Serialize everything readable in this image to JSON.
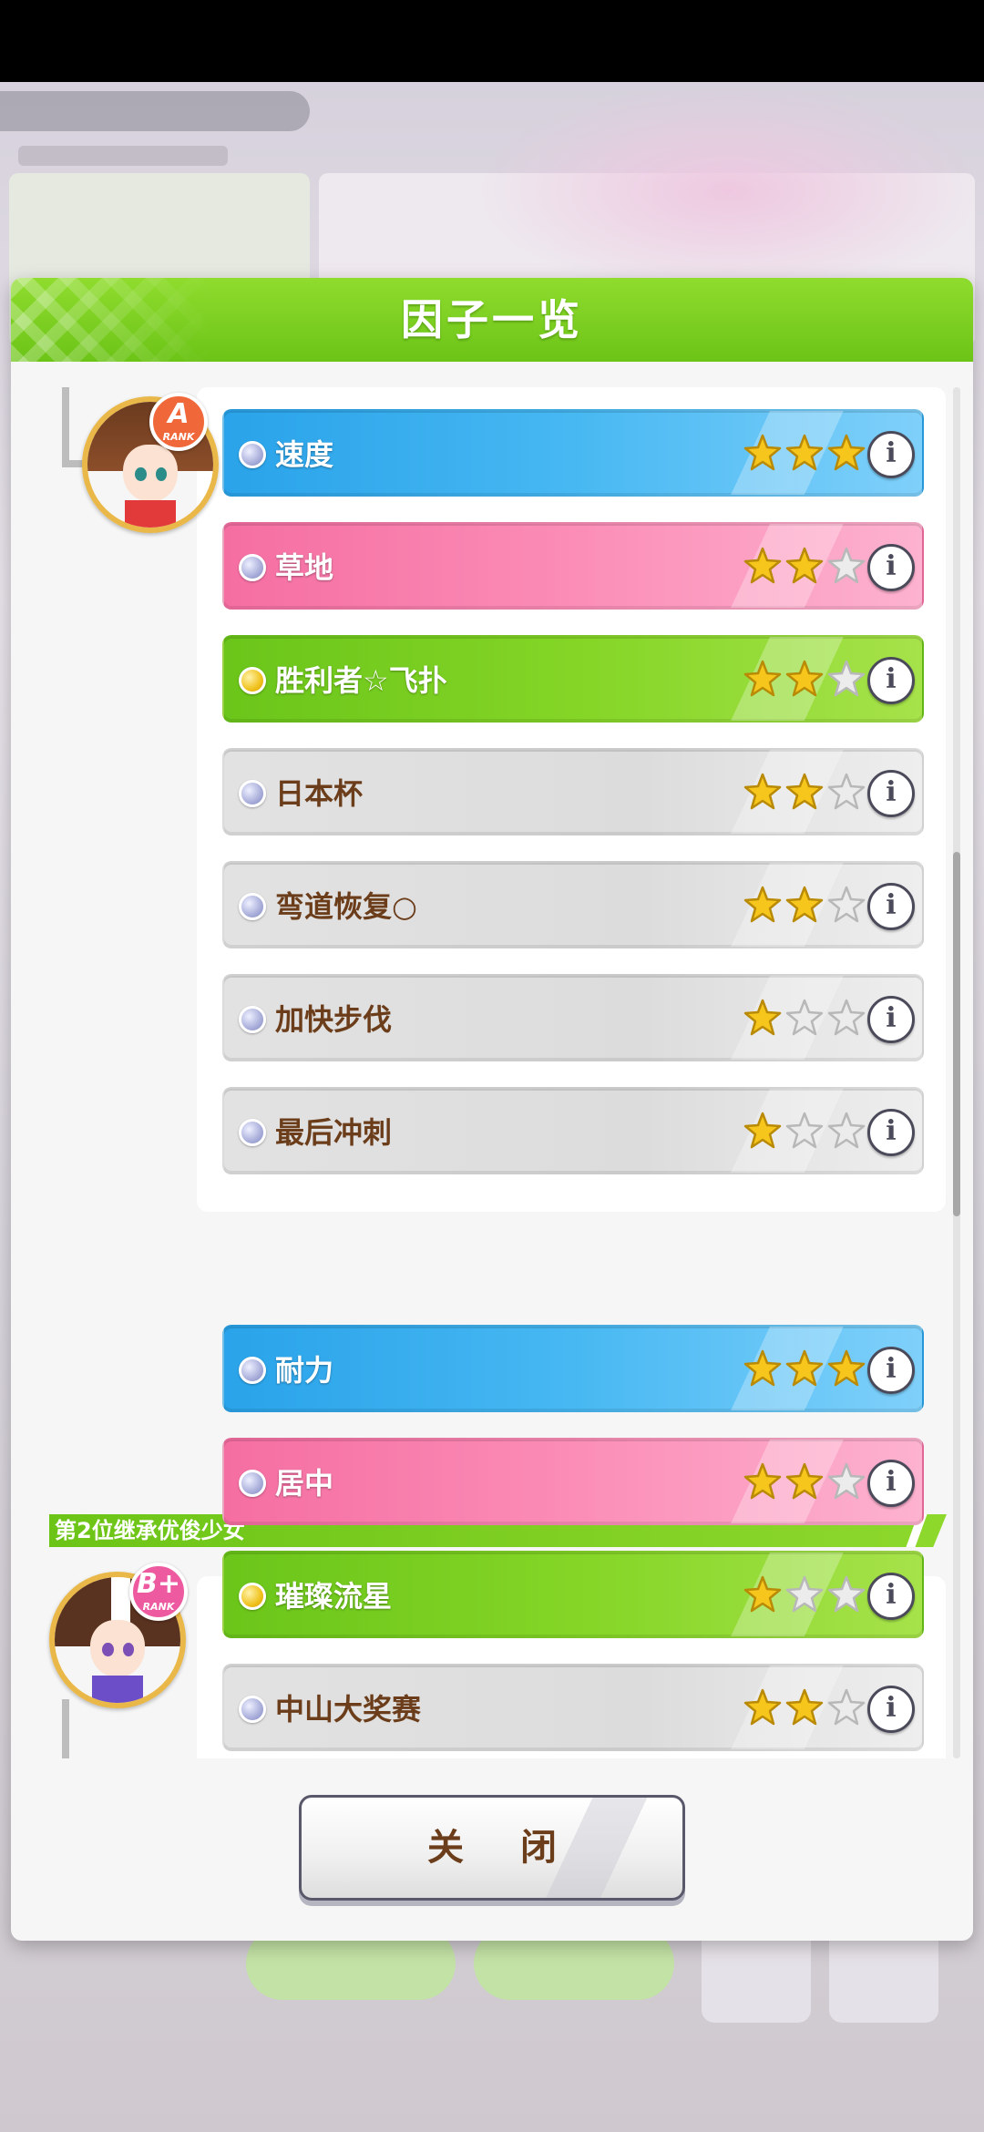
{
  "dialog": {
    "title": "因子一览",
    "close_label": "关 闭"
  },
  "colors": {
    "header_green": "#6cc417",
    "blue_factor": "#47b8f2",
    "pink_factor": "#fb8db6",
    "green_factor": "#84d526",
    "gray_factor": "#dcdcdc",
    "brown_text": "#6b3d1a"
  },
  "parents": [
    {
      "rank": "A",
      "rank_sub": "RANK",
      "rank_color": "#f0683a",
      "factors": [
        {
          "name": "速度",
          "color": "blue",
          "orb": "silver",
          "stars": 3
        },
        {
          "name": "草地",
          "color": "pink",
          "orb": "silver",
          "stars": 2
        },
        {
          "name": "胜利者☆飞扑",
          "color": "green",
          "orb": "gold",
          "stars": 2
        },
        {
          "name": "日本杯",
          "color": "gray",
          "orb": "silver",
          "stars": 2
        },
        {
          "name": "弯道恢复○",
          "color": "gray",
          "orb": "silver",
          "stars": 2
        },
        {
          "name": "加快步伐",
          "color": "gray",
          "orb": "silver",
          "stars": 1
        },
        {
          "name": "最后冲刺",
          "color": "gray",
          "orb": "silver",
          "stars": 1
        }
      ]
    },
    {
      "section_title": "第2位继承优俊少女",
      "rank": "B+",
      "rank_sub": "RANK",
      "rank_color": "#ee5aa0",
      "factors": [
        {
          "name": "耐力",
          "color": "blue",
          "orb": "silver",
          "stars": 3
        },
        {
          "name": "居中",
          "color": "pink",
          "orb": "silver",
          "stars": 2
        },
        {
          "name": "璀璨流星",
          "color": "green",
          "orb": "gold",
          "stars": 1
        },
        {
          "name": "中山大奖赛",
          "color": "gray",
          "orb": "silver",
          "stars": 2
        }
      ]
    }
  ]
}
